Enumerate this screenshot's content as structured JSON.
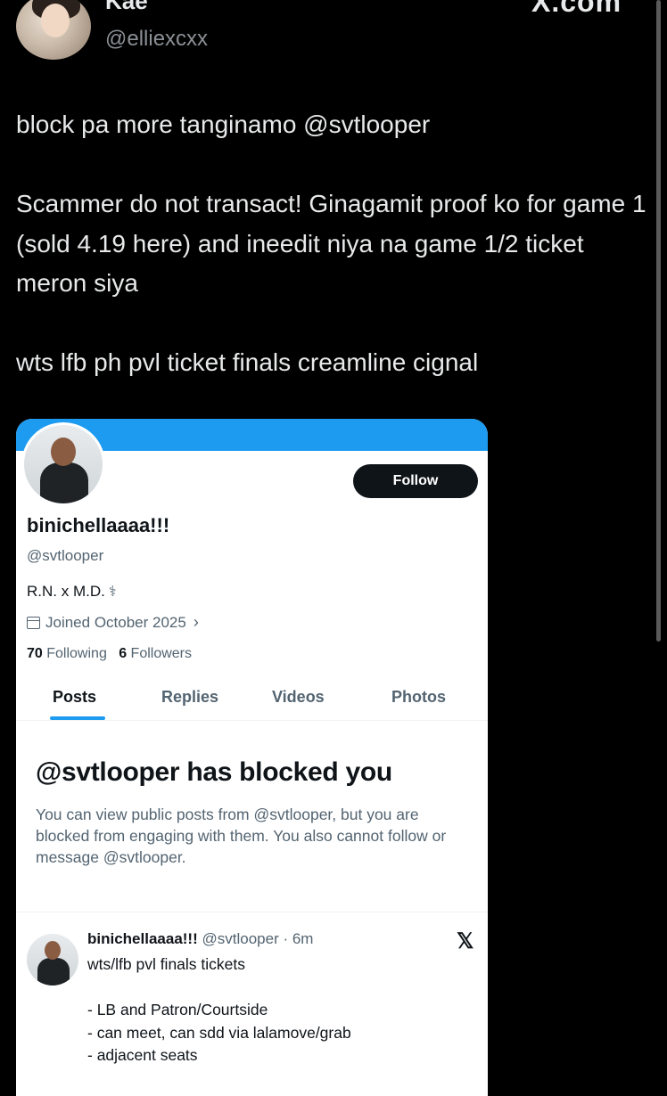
{
  "tweet": {
    "author_name": "Kae",
    "author_handle": "@elliexcxx",
    "brand_watermark": "X.com",
    "paragraphs": [
      "block pa more tanginamo @svtlooper",
      "Scammer do not transact! Ginagamit proof ko for game 1 (sold 4.19 here) and ineedit niya na game 1/2 ticket meron siya",
      "wts lfb ph pvl ticket finals creamline cignal"
    ]
  },
  "card": {
    "follow_label": "Follow",
    "display_name": "binichellaaaa!!!",
    "handle": "@svtlooper",
    "bio": "R.N. x M.D.",
    "bio_icon": "stethoscope",
    "joined": "Joined October 2025",
    "following_count": "70",
    "following_label": "Following",
    "followers_count": "6",
    "followers_label": "Followers",
    "tabs": [
      "Posts",
      "Replies",
      "Videos",
      "Photos"
    ],
    "active_tab": "Posts",
    "accent_color": "#1d9bf0",
    "blocked_title": "@svtlooper has blocked you",
    "blocked_desc": "You can view public posts from @svtlooper, but you are blocked from engaging with them. You also cannot follow or message @svtlooper.",
    "post": {
      "name": "binichellaaaa!!!",
      "handle_time": "@svtlooper · 6m",
      "lines": [
        "wts/lfb pvl finals tickets",
        "",
        "- LB and Patron/Courtside",
        "- can meet, can sdd via lalamove/grab",
        "- adjacent seats"
      ]
    }
  }
}
